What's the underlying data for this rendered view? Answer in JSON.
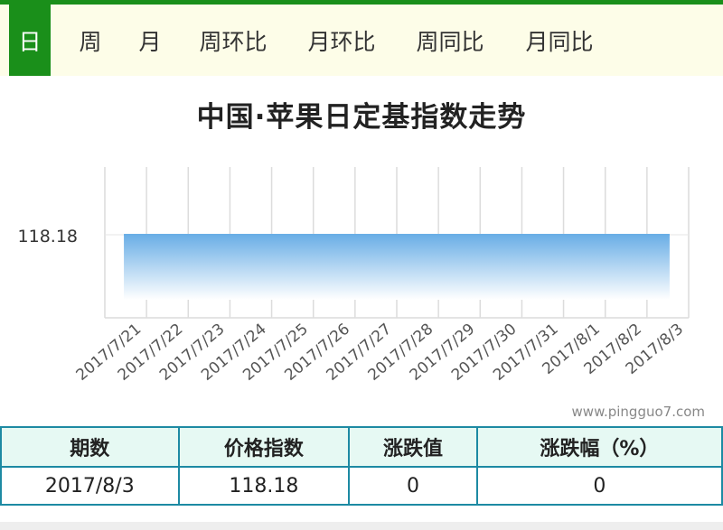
{
  "tabs": [
    {
      "label": "日",
      "active": true
    },
    {
      "label": "周",
      "active": false
    },
    {
      "label": "月",
      "active": false
    },
    {
      "label": "周环比",
      "active": false
    },
    {
      "label": "月环比",
      "active": false
    },
    {
      "label": "周同比",
      "active": false
    },
    {
      "label": "月同比",
      "active": false
    }
  ],
  "watermark": "www.pingguo7.com",
  "colors": {
    "accent_green": "#1a8f1a",
    "tab_bar_bg": "#fdfde8",
    "area_top": "#6aaee6",
    "area_bottom": "#ffffff",
    "table_border": "#1d8aa3",
    "table_header_bg": "#e6f9f3"
  },
  "chart_data": {
    "type": "area",
    "title": "中国·苹果日定基指数走势",
    "xlabel": "",
    "ylabel": "",
    "categories": [
      "2017/7/21",
      "2017/7/22",
      "2017/7/23",
      "2017/7/24",
      "2017/7/25",
      "2017/7/26",
      "2017/7/27",
      "2017/7/28",
      "2017/7/29",
      "2017/7/30",
      "2017/7/31",
      "2017/8/1",
      "2017/8/2",
      "2017/8/3"
    ],
    "series": [
      {
        "values": [
          118.18,
          118.18,
          118.18,
          118.18,
          118.18,
          118.18,
          118.18,
          118.18,
          118.18,
          118.18,
          118.18,
          118.18,
          118.18,
          118.18
        ]
      }
    ],
    "y_ticks": [
      118.18
    ],
    "grid": "vertical",
    "legend": "none"
  },
  "table": {
    "headers": [
      "期数",
      "价格指数",
      "涨跌值",
      "涨跌幅（%）"
    ],
    "rows": [
      [
        "2017/8/3",
        "118.18",
        "0",
        "0"
      ]
    ]
  }
}
